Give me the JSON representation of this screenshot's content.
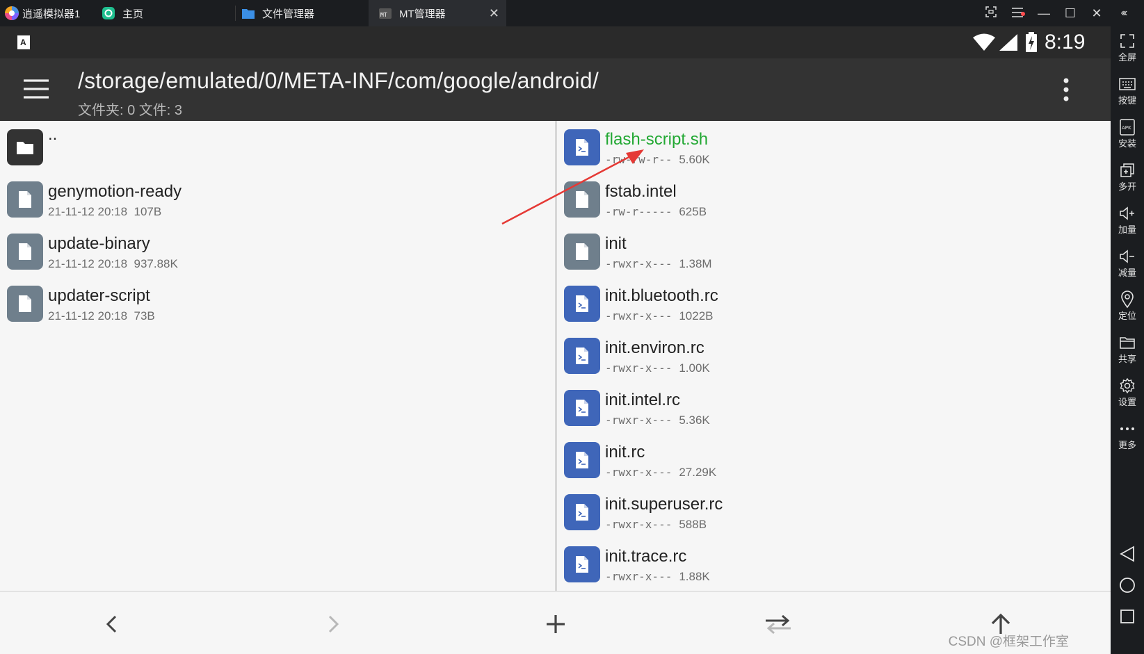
{
  "tabs": {
    "app": "逍遥模拟器1",
    "home": "主页",
    "file_manager": "文件管理器",
    "mt": "MT管理器"
  },
  "status": {
    "time": "8:19"
  },
  "appbar": {
    "path": "/storage/emulated/0/META-INF/com/google/android/",
    "summary": "文件夹: 0  文件: 3"
  },
  "left_pane": {
    "parent": "..",
    "files": [
      {
        "name": "genymotion-ready",
        "date": "21-11-12 20:18",
        "size": "107B"
      },
      {
        "name": "update-binary",
        "date": "21-11-12 20:18",
        "size": "937.88K"
      },
      {
        "name": "updater-script",
        "date": "21-11-12 20:18",
        "size": "73B"
      }
    ]
  },
  "right_pane": {
    "files": [
      {
        "name": "flash-script.sh",
        "perm": "-rw-rw-r--",
        "size": "5.60K",
        "icon": "script",
        "highlight": true
      },
      {
        "name": "fstab.intel",
        "perm": "-rw-r-----",
        "size": "625B",
        "icon": "file"
      },
      {
        "name": "init",
        "perm": "-rwxr-x---",
        "size": "1.38M",
        "icon": "file"
      },
      {
        "name": "init.bluetooth.rc",
        "perm": "-rwxr-x---",
        "size": "1022B",
        "icon": "script"
      },
      {
        "name": "init.environ.rc",
        "perm": "-rwxr-x---",
        "size": "1.00K",
        "icon": "script"
      },
      {
        "name": "init.intel.rc",
        "perm": "-rwxr-x---",
        "size": "5.36K",
        "icon": "script"
      },
      {
        "name": "init.rc",
        "perm": "-rwxr-x---",
        "size": "27.29K",
        "icon": "script"
      },
      {
        "name": "init.superuser.rc",
        "perm": "-rwxr-x---",
        "size": "588B",
        "icon": "script"
      },
      {
        "name": "init.trace.rc",
        "perm": "-rwxr-x---",
        "size": "1.88K",
        "icon": "script"
      }
    ]
  },
  "sidebar": [
    {
      "label": "全屏",
      "icon": "fullscreen-icon"
    },
    {
      "label": "按键",
      "icon": "keyboard-icon"
    },
    {
      "label": "安装",
      "icon": "apk-install-icon"
    },
    {
      "label": "多开",
      "icon": "multi-instance-icon"
    },
    {
      "label": "加量",
      "icon": "volume-up-icon"
    },
    {
      "label": "减量",
      "icon": "volume-down-icon"
    },
    {
      "label": "定位",
      "icon": "location-icon"
    },
    {
      "label": "共享",
      "icon": "shared-folder-icon"
    },
    {
      "label": "设置",
      "icon": "settings-icon"
    },
    {
      "label": "更多",
      "icon": "more-icon"
    }
  ],
  "colors": {
    "highlight_green": "#22a833",
    "script_icon_blue": "#3f66b9",
    "file_icon_gray": "#6f7f8c",
    "annotation_arrow": "#e53935"
  },
  "watermark": "CSDN @框架工作室"
}
